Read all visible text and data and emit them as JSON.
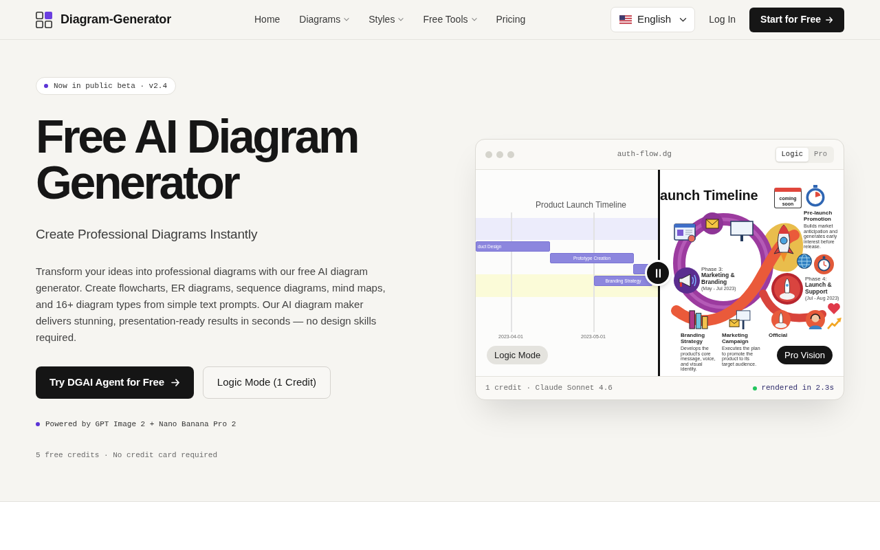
{
  "header": {
    "brand": "Diagram-Generator",
    "nav": [
      {
        "label": "Home",
        "kind": "link"
      },
      {
        "label": "Diagrams",
        "kind": "dropdown"
      },
      {
        "label": "Styles",
        "kind": "dropdown"
      },
      {
        "label": "Free Tools",
        "kind": "dropdown"
      },
      {
        "label": "Pricing",
        "kind": "link"
      }
    ],
    "language": "English",
    "login": "Log In",
    "cta": "Start for Free"
  },
  "hero": {
    "badge": "Now in public beta · v2.4",
    "title": "Free AI Diagram Generator",
    "subtitle": "Create Professional Diagrams Instantly",
    "description": "Transform your ideas into professional diagrams with our free AI diagram generator. Create flowcharts, ER diagrams, sequence diagrams, mind maps, and 16+ diagram types from simple text prompts. Our AI diagram maker delivers stunning, presentation-ready results in seconds — no design skills required.",
    "buttons": [
      {
        "label": "Try DGAI Agent for Free",
        "kind": "primary"
      },
      {
        "label": "Logic Mode (1 Credit)",
        "kind": "secondary"
      }
    ],
    "powered_by": "Powered by GPT Image 2 + Nano Banana Pro 2",
    "note": "5 free credits · No credit card required"
  },
  "preview": {
    "filename": "auth-flow.dg",
    "modes": [
      {
        "label": "Logic",
        "selected": true
      },
      {
        "label": "Pro",
        "selected": false
      }
    ],
    "logic_render": {
      "title": "Product Launch Timeline",
      "tasks": [
        "duct Design",
        "Prototype Creation",
        "Branding Strategy"
      ],
      "axis_labels": [
        "2023-04-01",
        "2023-05-01"
      ],
      "label": "Logic Mode"
    },
    "pro_render": {
      "title": "aunch Timeline",
      "badge": "coming soon",
      "callouts": [
        {
          "kind": "step",
          "heading": "Pre-launch Promotion",
          "text": "Builds market anticipation and generates early interest before release."
        },
        {
          "kind": "phase",
          "kicker": "Phase 3:",
          "heading": "Marketing & Branding",
          "dates": "(May - Jul 2023)"
        },
        {
          "kind": "phase",
          "kicker": "Phase 4:",
          "heading": "Launch & Support",
          "dates": "(Jul - Aug 2023)"
        },
        {
          "kind": "step",
          "heading": "Branding Strategy",
          "text": "Develops the product's core message, voice, and visual identity."
        },
        {
          "kind": "step",
          "heading": "Marketing Campaign",
          "text": "Executes the plan to promote the product to its target audience."
        },
        {
          "kind": "label",
          "heading": "Official"
        }
      ],
      "label": "Pro Vision"
    },
    "footer": {
      "model": "1 credit · Claude Sonnet 4.6",
      "status": "rendered in 2.3s"
    }
  }
}
